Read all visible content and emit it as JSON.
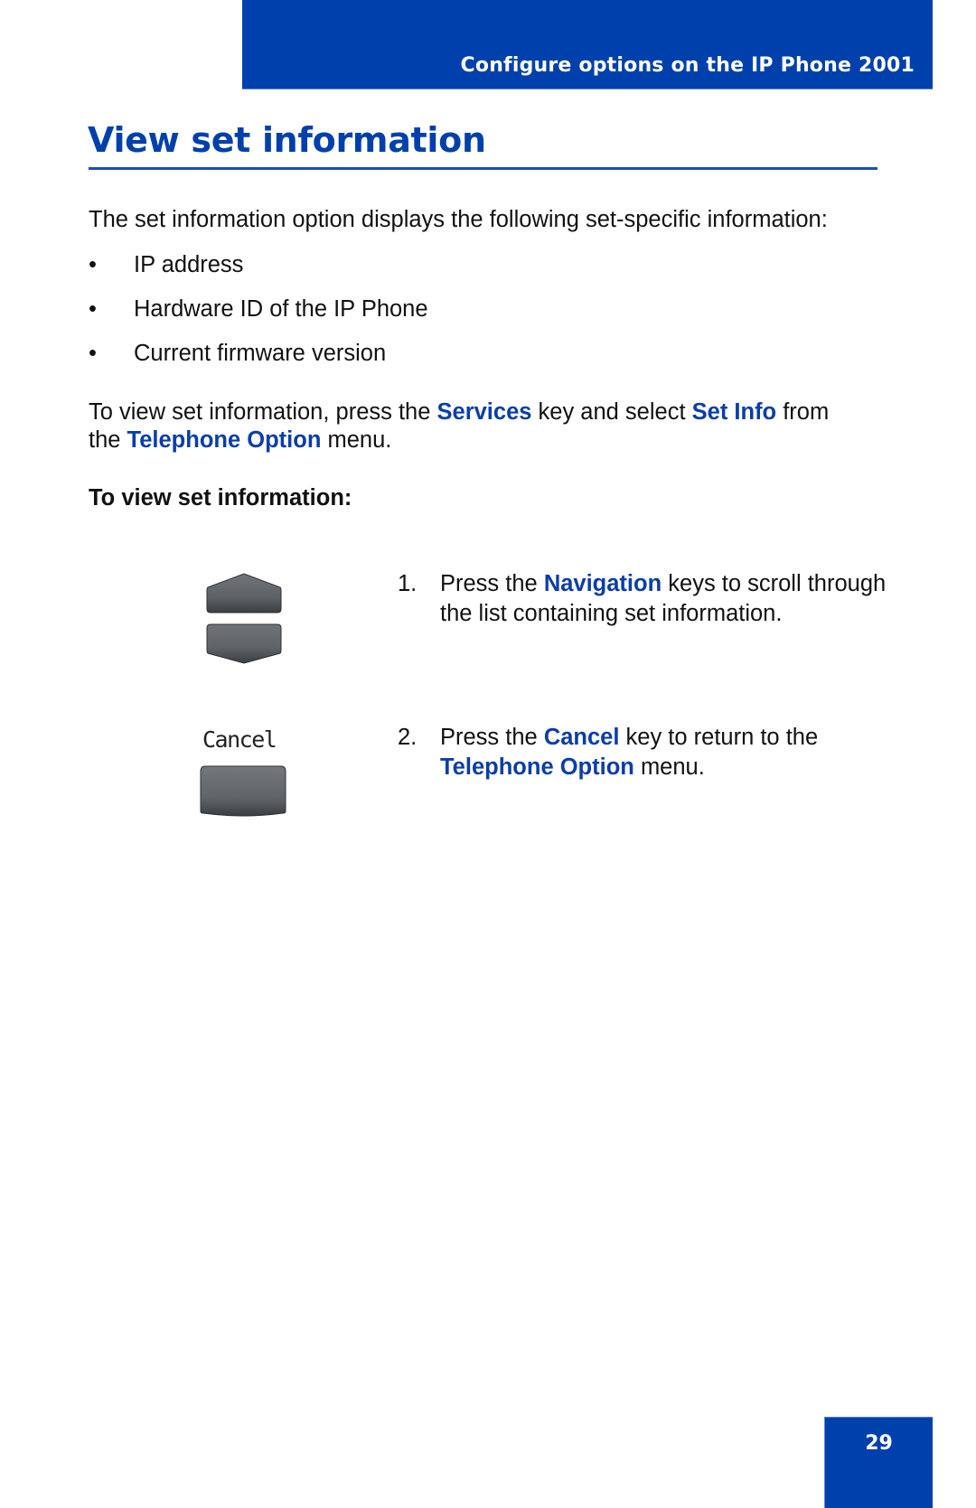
{
  "header": {
    "section_title": "Configure options on the IP Phone 2001",
    "accent_color": "#0040ac"
  },
  "page": {
    "title": "View set information",
    "intro": "The set information option displays the following set-specific information:",
    "bullets": [
      "IP address",
      "Hardware ID of the IP Phone",
      "Current firmware version"
    ],
    "para": {
      "t1": "To view set information, press the ",
      "k1": "Services",
      "t2": " key and select ",
      "k2": "Set Info",
      "t3": " from the ",
      "k3": "Telephone Option",
      "t4": " menu."
    },
    "procedure_heading": "To view set information:",
    "steps": [
      {
        "number": "1.",
        "t1": "Press the ",
        "k1": "Navigation",
        "t2": " keys to scroll through the list containing set information.",
        "icon": "navigation-keys-icon"
      },
      {
        "number": "2.",
        "t1": "Press the ",
        "k1": "Cancel",
        "t2": " key to return to the ",
        "k2": "Telephone Option",
        "t3": " menu.",
        "icon": "cancel-softkey-icon",
        "softkey_label": "Cancel"
      }
    ]
  },
  "footer": {
    "page_number": "29"
  }
}
